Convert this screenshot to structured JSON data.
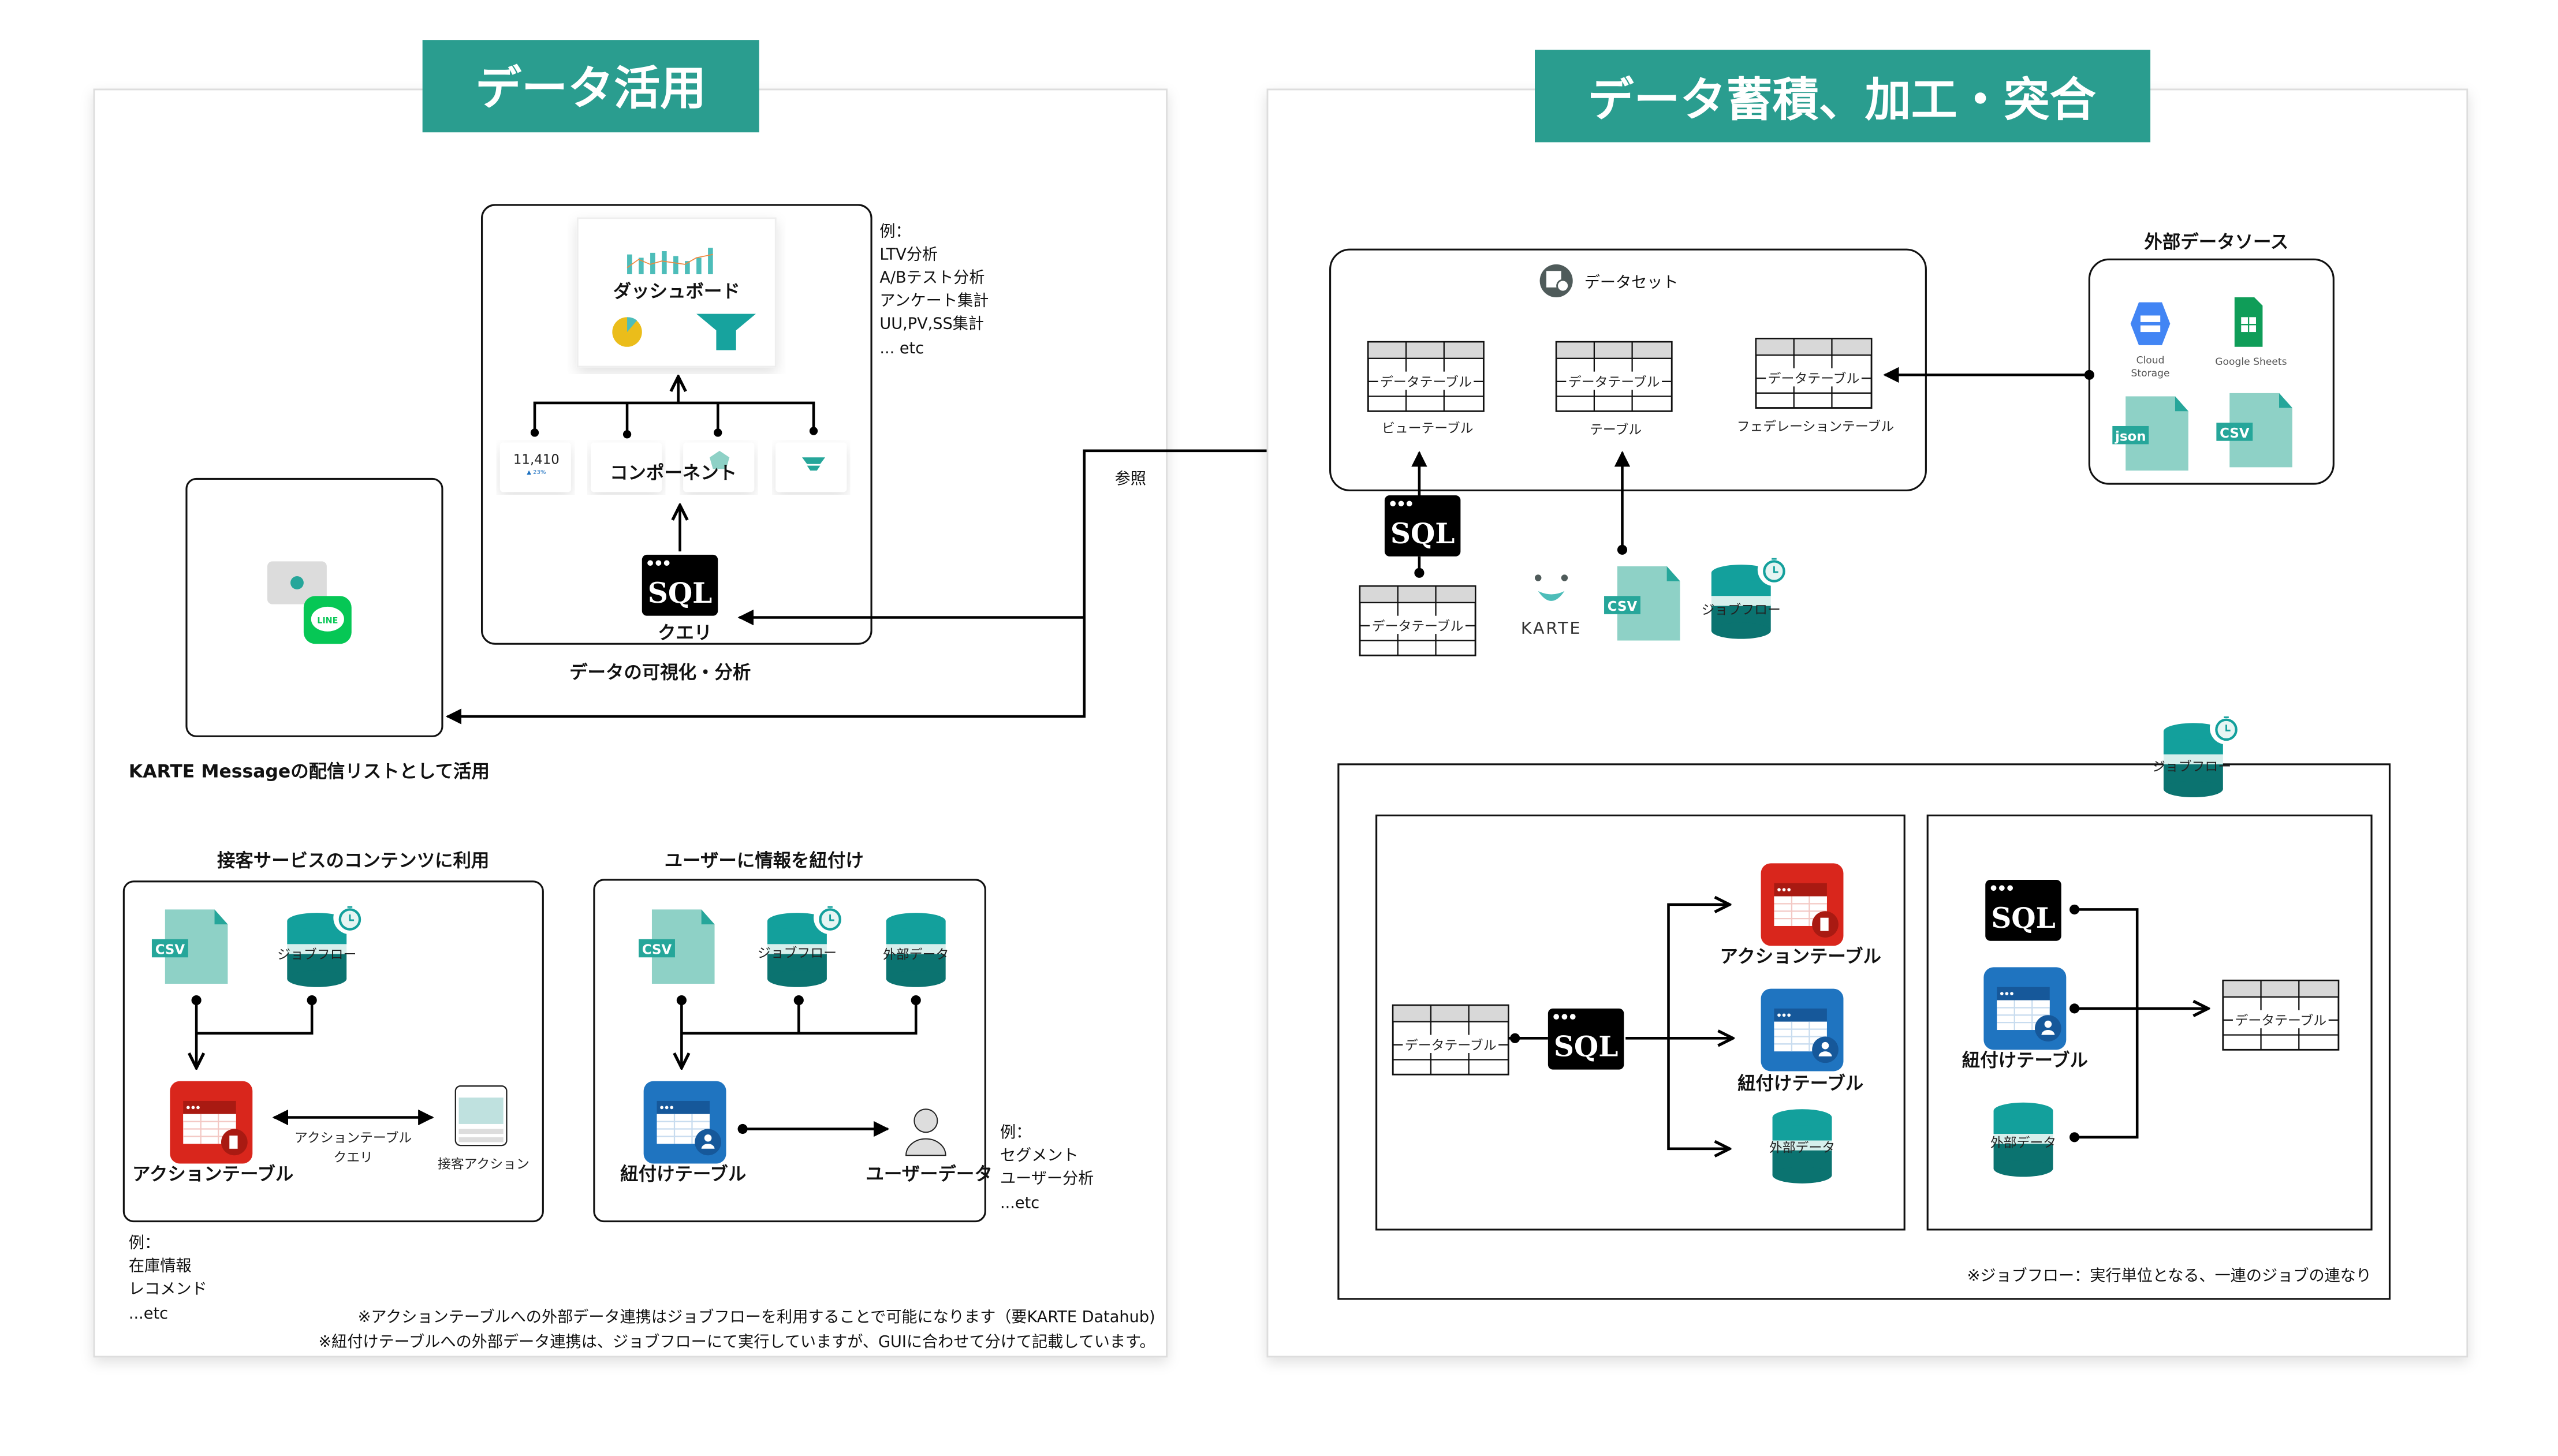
{
  "colors": {
    "teal_title": "#2a9d8f",
    "action_red": "#d9261c",
    "link_blue": "#1f74c0",
    "db_teal": "#13a09c",
    "db_dark": "#0b7370",
    "csv_light": "#8ed1c6",
    "csv_badge": "#26a69a",
    "line_green": "#06c755"
  },
  "icons": {
    "sql_label": "SQL",
    "csv_label": "CSV",
    "json_label": "json",
    "line_logo": "LINE",
    "karte_logo": "KARTE"
  },
  "left": {
    "title": "データ活用",
    "dashboard": {
      "label": "ダッシュボード",
      "kpi_value": "11,410",
      "kpi_delta": "▲ 23%"
    },
    "component_label": "コンポーネント",
    "query_label": "クエリ",
    "viz_caption": "データの可視化・分析",
    "viz_examples": [
      "例：",
      "LTV分析",
      "A/Bテスト分析",
      "アンケート集計",
      "UU,PV,SS集計",
      "... etc"
    ],
    "reference_label": "参照",
    "message_caption": "KARTE Messageの配信リストとして活用",
    "service": {
      "title": "接客サービスのコンテンツに利用",
      "jobflow_label": "ジョブフロー",
      "action_table_label": "アクションテーブル",
      "arrow_label": [
        "アクションテーブル",
        "クエリ"
      ],
      "action_label": "接客アクション",
      "examples": [
        "例：",
        "在庫情報",
        "レコメンド",
        "...etc"
      ]
    },
    "user": {
      "title": "ユーザーに情報を紐付け",
      "jobflow_label": "ジョブフロー",
      "external_label": "外部データ",
      "link_table_label": "紐付けテーブル",
      "user_data_label": "ユーザーデータ",
      "examples": [
        "例：",
        "セグメント",
        "ユーザー分析",
        "...etc"
      ]
    },
    "notes": [
      "※アクションテーブルへの外部データ連携はジョブフローを利用することで可能になります（要KARTE Datahub)",
      "※紐付けテーブルへの外部データ連携は、ジョブフローにて実行していますが、GUIに合わせて分けて記載しています。"
    ]
  },
  "right": {
    "title": "データ蓄積、加工・突合",
    "dataset": {
      "title": "データセット",
      "table_inner_label": "データテーブル",
      "tables": [
        {
          "label": "ビューテーブル"
        },
        {
          "label": "テーブル"
        },
        {
          "label": "フェデレーションテーブル"
        }
      ]
    },
    "external": {
      "title": "外部データソース",
      "cloud_storage": [
        "Cloud",
        "Storage"
      ],
      "google_sheets": "Google Sheets"
    },
    "source_table_label": "データテーブル",
    "jobflow_label": "ジョブフロー",
    "jobflow_panel": {
      "label": "ジョブフロー",
      "left": {
        "table_label": "データテーブル",
        "outputs": [
          "アクションテーブル",
          "紐付けテーブル",
          "外部データ"
        ]
      },
      "right": {
        "inputs": [
          "紐付けテーブル",
          "外部データ"
        ],
        "table_label": "データテーブル"
      },
      "note": "※ジョブフロー：実行単位となる、一連のジョブの連なり"
    }
  }
}
